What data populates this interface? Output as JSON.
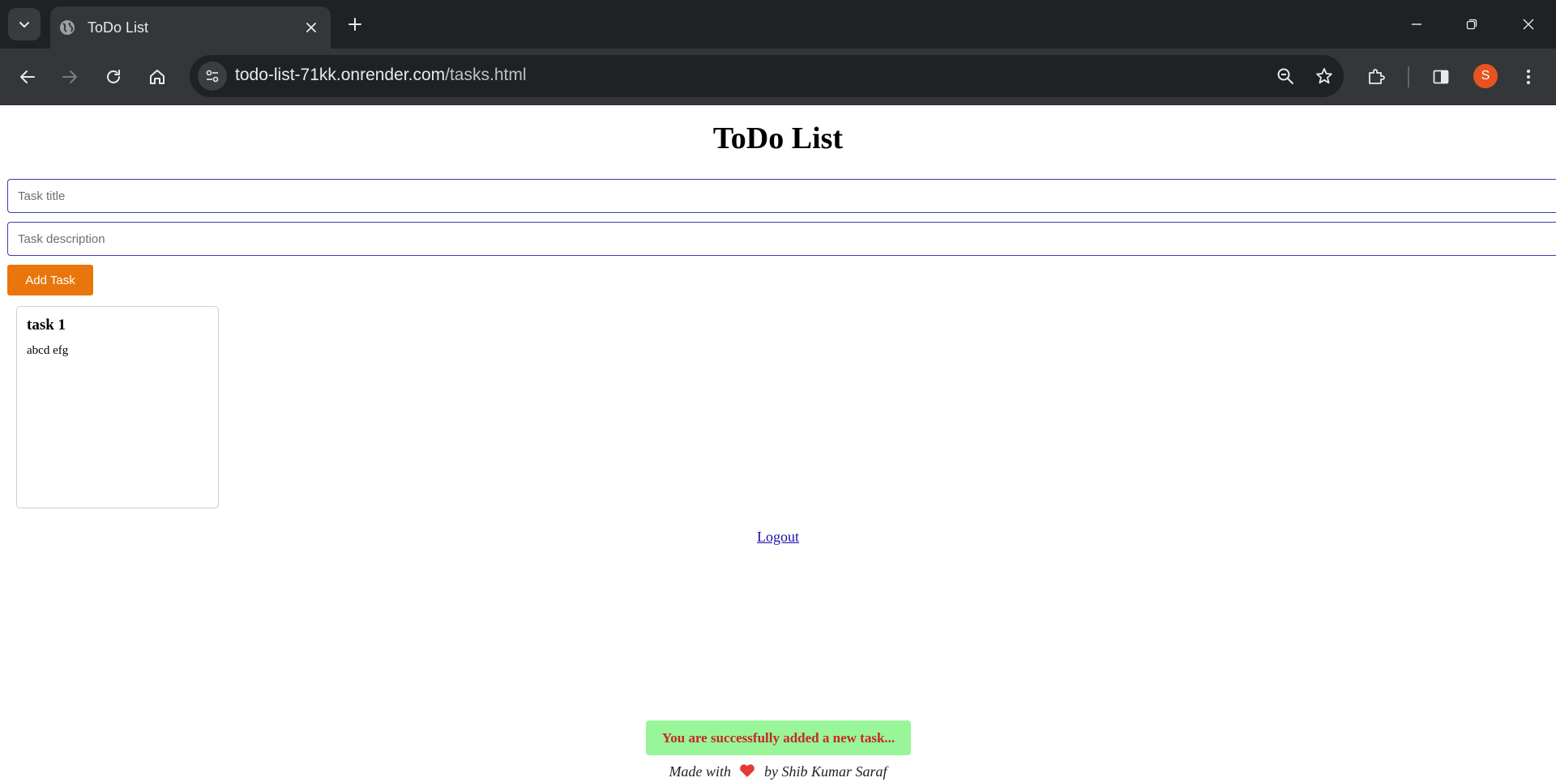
{
  "browser": {
    "tab_title": "ToDo List",
    "url_domain": "todo-list-71kk.onrender.com",
    "url_path": "/tasks.html",
    "profile_initial": "S",
    "colors": {
      "tabbar": "#202124",
      "toolbar": "#35363a",
      "avatar": "#e8541e"
    }
  },
  "page": {
    "title": "ToDo List",
    "task_title_placeholder": "Task title",
    "task_title_value": "",
    "task_desc_placeholder": "Task description",
    "task_desc_value": "",
    "add_button_label": "Add Task",
    "tasks": [
      {
        "title": "task 1",
        "description": "abcd efg"
      }
    ],
    "logout_label": "Logout",
    "toast_message": "You are successfully added a new task...",
    "footer_prefix": "Made with",
    "footer_suffix": "by Shib Kumar Saraf",
    "colors": {
      "add_button": "#e8760c",
      "input_border": "#3b3bb0",
      "toast_bg": "#98f598",
      "toast_text": "#c62828",
      "heart": "#e53935"
    }
  }
}
